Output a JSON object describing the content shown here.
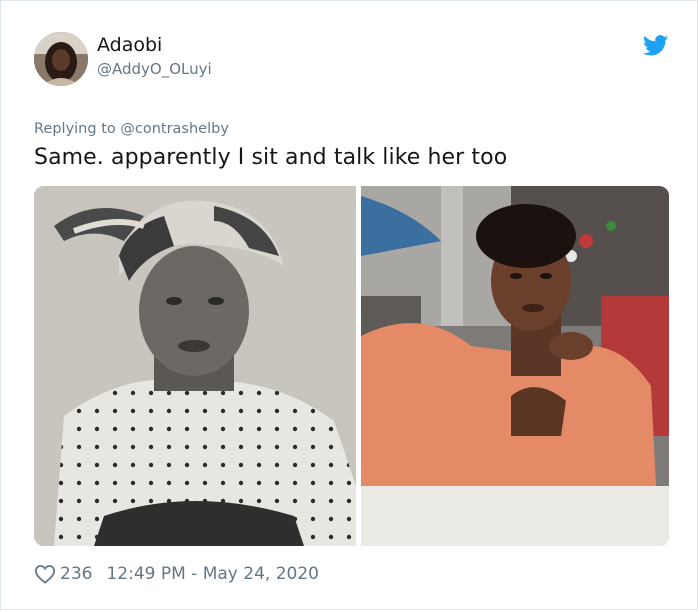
{
  "tweet": {
    "author": {
      "display_name": "Adaobi",
      "handle": "@AddyO_OLuyi",
      "avatar_icon": "profile-photo"
    },
    "brand_icon": "twitter-bird-icon",
    "brand_color": "#1da1f2",
    "reply_context": "Replying to @contrashelby",
    "text": "Same. apparently I sit and talk like her too",
    "media": [
      {
        "kind": "photo",
        "description_icon": "vintage-portrait-photo"
      },
      {
        "kind": "photo",
        "description_icon": "modern-portrait-photo"
      }
    ],
    "likes": "236",
    "timestamp": "12:49 PM - May 24, 2020",
    "like_icon": "heart-icon"
  }
}
